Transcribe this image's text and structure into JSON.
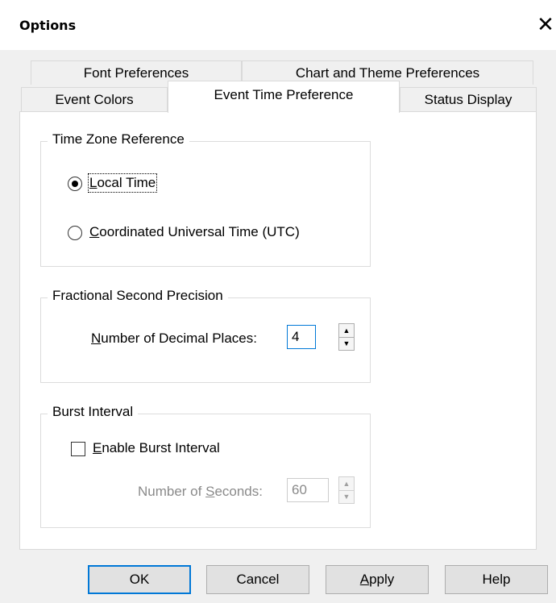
{
  "window": {
    "title": "Options",
    "close_icon": "close-icon"
  },
  "tabs": {
    "row1": [
      "Font Preferences",
      "Chart and Theme Preferences"
    ],
    "row2": [
      "Event Colors",
      "Event Time Preference",
      "Status Display"
    ],
    "active": "Event Time Preference"
  },
  "time_zone": {
    "title": "Time Zone Reference",
    "options": [
      {
        "label_prefix": "L",
        "label_rest": "ocal Time",
        "selected": true
      },
      {
        "label_prefix": "C",
        "label_rest": "oordinated Universal Time (UTC)",
        "selected": false
      }
    ]
  },
  "precision": {
    "title": "Fractional Second Precision",
    "label_prefix": "N",
    "label_rest": "umber of Decimal Places:",
    "value": "4"
  },
  "burst": {
    "title": "Burst Interval",
    "checkbox_prefix": "E",
    "checkbox_rest": "nable Burst Interval",
    "checked": false,
    "seconds_label_before": "Number of ",
    "seconds_label_key": "S",
    "seconds_label_after": "econds:",
    "seconds_value": "60"
  },
  "buttons": {
    "ok": "OK",
    "cancel": "Cancel",
    "apply_prefix": "A",
    "apply_rest": "pply",
    "help": "Help"
  }
}
